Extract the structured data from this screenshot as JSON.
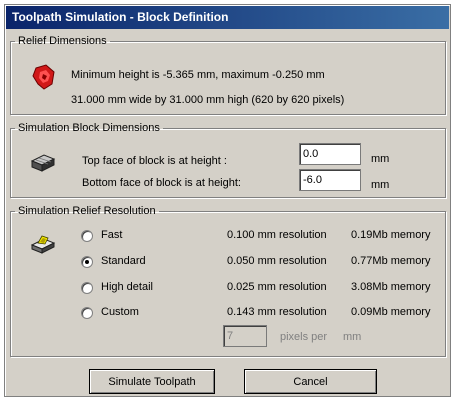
{
  "window": {
    "title": "Toolpath Simulation - Block Definition"
  },
  "relief": {
    "legend": "Relief Dimensions",
    "icon": "relief-red-icon",
    "line1": "Minimum height is -5.365 mm, maximum -0.250 mm",
    "line2": "31.000 mm wide by 31.000 mm high (620 by 620 pixels)"
  },
  "block": {
    "legend": "Simulation Block Dimensions",
    "icon": "block-icon",
    "top_label": "Top face of block is at height :",
    "top_value": "0.0",
    "top_unit": "mm",
    "bottom_label": "Bottom face of block is at height:",
    "bottom_value": "-6.0",
    "bottom_unit": "mm"
  },
  "resolution": {
    "legend": "Simulation Relief Resolution",
    "icon": "resolution-icon",
    "options": [
      {
        "label": "Fast",
        "res": "0.100 mm resolution",
        "mem": "0.19Mb memory",
        "selected": false
      },
      {
        "label": "Standard",
        "res": "0.050 mm resolution",
        "mem": "0.77Mb memory",
        "selected": true
      },
      {
        "label": "High detail",
        "res": "0.025 mm resolution",
        "mem": "3.08Mb memory",
        "selected": false
      },
      {
        "label": "Custom",
        "res": "0.143 mm resolution",
        "mem": "0.09Mb memory",
        "selected": false
      }
    ],
    "custom_value": "7",
    "pixels_label": "pixels per",
    "pixels_unit": "mm"
  },
  "buttons": {
    "simulate": "Simulate Toolpath",
    "cancel": "Cancel"
  }
}
